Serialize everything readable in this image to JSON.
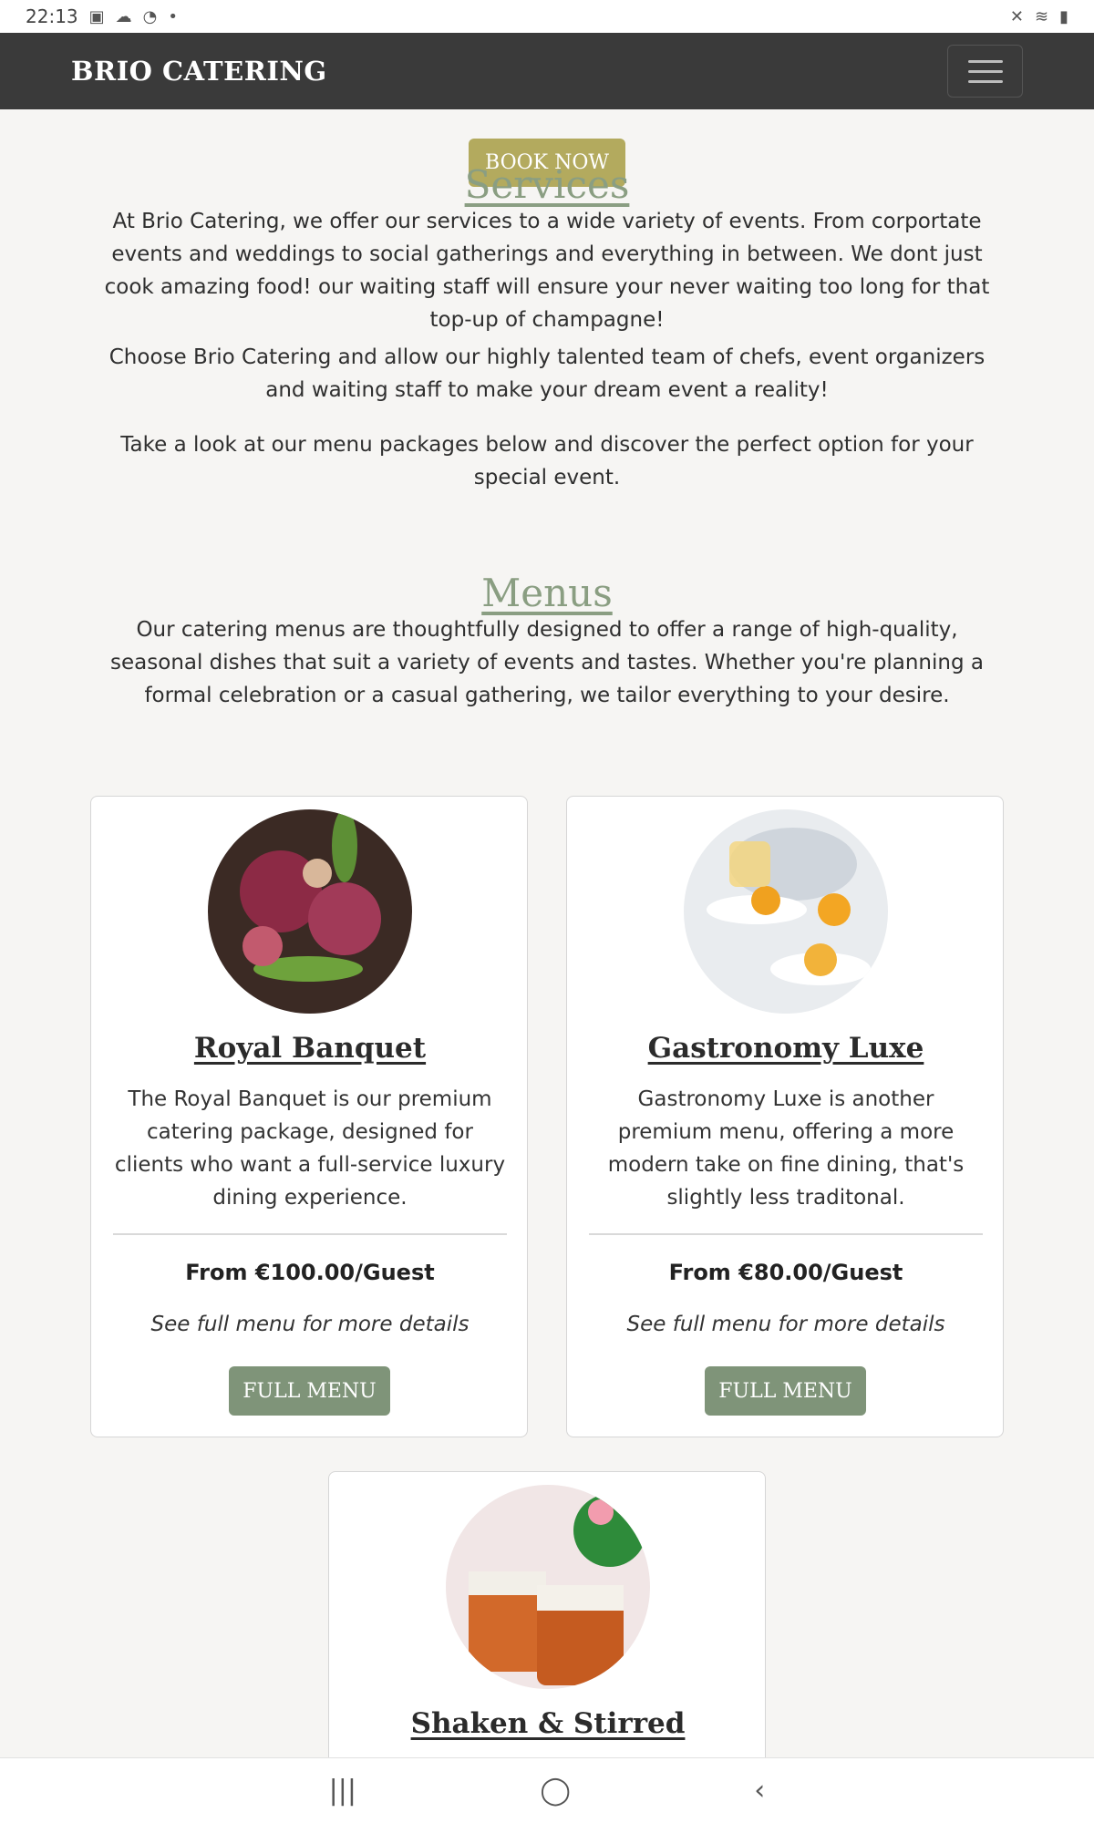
{
  "status_bar": {
    "time": "22:13",
    "left_icons": [
      "image-icon",
      "cloud-icon",
      "whatsapp-icon",
      "dot-icon"
    ],
    "right_icons": [
      "mute-icon",
      "wifi-icon",
      "battery-icon"
    ]
  },
  "navbar": {
    "brand": "BRIO CATERING",
    "menu_icon": "hamburger-menu-icon"
  },
  "book_button": "BOOK NOW",
  "services": {
    "title": "Services",
    "paragraphs": [
      "At Brio Catering, we offer our services to a wide variety of events. From corportate events and weddings to social gatherings and everything in between. We dont just cook amazing food! our waiting staff will ensure your never waiting too long for that top-up of champagne!",
      "Choose Brio Catering and allow our highly talented team of chefs, event organizers and waiting staff to make your dream event a reality!",
      "Take a look at our menu packages below and discover the perfect option for your special event."
    ]
  },
  "menus": {
    "title": "Menus",
    "intro": "Our catering menus are thoughtfully designed to offer a range of high-quality, seasonal dishes that suit a variety of events and tastes. Whether you're planning a formal celebration or a casual gathering, we tailor everything to your desire.",
    "cards": [
      {
        "title": "Royal Banquet",
        "description": "The Royal Banquet is our premium catering package, designed for clients who want a full-service luxury dining experience.",
        "price": "From €100.00/Guest",
        "note": "See full menu for more details",
        "button": "FULL MENU"
      },
      {
        "title": "Gastronomy Luxe",
        "description": "Gastronomy Luxe is another premium menu, offering a more modern take on fine dining, that's slightly less traditonal.",
        "price": "From €80.00/Guest",
        "note": "See full menu for more details",
        "button": "FULL MENU"
      },
      {
        "title": "Shaken & Stirred"
      }
    ]
  },
  "bottom_nav": {
    "recents": "|||",
    "home": "◯",
    "back": "‹"
  },
  "colors": {
    "navbar_bg": "#3a3a3a",
    "book_button": "#b3aa5e",
    "section_title": "#8a9e82",
    "full_menu_button": "#7f9479",
    "page_bg": "#f6f5f3"
  }
}
